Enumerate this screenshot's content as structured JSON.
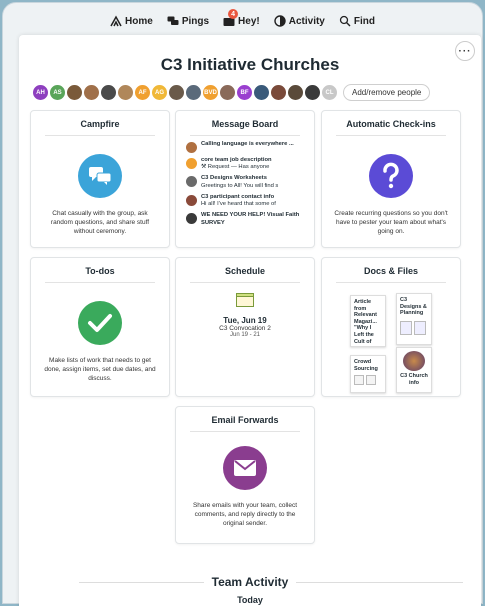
{
  "nav": {
    "home": "Home",
    "pings": "Pings",
    "hey": "Hey!",
    "hey_badge": "4",
    "activity": "Activity",
    "find": "Find"
  },
  "project": {
    "title": "C3 Initiative Churches",
    "add_people": "Add/remove people",
    "avatars": [
      {
        "initials": "AH",
        "color": "#8e3fbf"
      },
      {
        "initials": "AS",
        "color": "#5aa55a"
      },
      {
        "initials": "",
        "color": "#7a5a3a"
      },
      {
        "initials": "",
        "color": "#a0704a"
      },
      {
        "initials": "",
        "color": "#4a4a4a"
      },
      {
        "initials": "",
        "color": "#b0875a"
      },
      {
        "initials": "AF",
        "color": "#f0a030"
      },
      {
        "initials": "AG",
        "color": "#f0b838"
      },
      {
        "initials": "",
        "color": "#6a5a4a"
      },
      {
        "initials": "",
        "color": "#5a6a7a"
      },
      {
        "initials": "BVD",
        "color": "#f0a030"
      },
      {
        "initials": "",
        "color": "#8a6a5a"
      },
      {
        "initials": "BF",
        "color": "#9a3fcf"
      },
      {
        "initials": "",
        "color": "#3a5a7a"
      },
      {
        "initials": "",
        "color": "#7a4a3a"
      },
      {
        "initials": "",
        "color": "#5a4a3a"
      },
      {
        "initials": "",
        "color": "#3a3a3a"
      },
      {
        "initials": "CL",
        "color": "#c8c8c8"
      }
    ]
  },
  "cards": {
    "campfire": {
      "title": "Campfire",
      "desc": "Chat casually with the group, ask random questions, and share stuff without ceremony."
    },
    "message_board": {
      "title": "Message Board",
      "messages": [
        {
          "title": "Calling language is everywhere ...",
          "snippet": "",
          "color": "#b07040"
        },
        {
          "title": "core team job description",
          "snippet": "⚒ Request — Has anyone",
          "color": "#f0a030"
        },
        {
          "title": "C3 Designs Worksheets",
          "snippet": "Greetings to All! You will find s",
          "color": "#6a6a6a"
        },
        {
          "title": "C3 participant contact info",
          "snippet": "Hi all! I've heard that some of",
          "color": "#8a4a3a"
        },
        {
          "title": "WE NEED YOUR HELP! Visual Faith SURVEY",
          "snippet": "",
          "color": "#3a3a3a"
        }
      ]
    },
    "checkins": {
      "title": "Automatic Check-ins",
      "desc": "Create recurring questions so you don't have to pester your team about what's going on."
    },
    "todos": {
      "title": "To-dos",
      "desc": "Make lists of work that needs to get done, assign items, set due dates, and discuss."
    },
    "schedule": {
      "title": "Schedule",
      "date": "Tue, Jun 19",
      "event": "C3 Convocation 2",
      "range": "Jun 19 - 21"
    },
    "docs": {
      "title": "Docs & Files",
      "doc1": "Article from Relevant Magazi... \"Why I Left the Cult of",
      "doc2": "C3 Designs & Planning",
      "doc3": "Crowd Sourcing",
      "doc4": "C3 Church info"
    },
    "email": {
      "title": "Email Forwards",
      "desc": "Share emails with your team, collect comments, and reply directly to the original sender."
    }
  },
  "activity": {
    "title": "Team Activity",
    "today": "Today"
  },
  "colors": {
    "campfire": "#3ba4d9",
    "checkins": "#5b4bd6",
    "todos": "#3aaa5c",
    "email": "#8a3d8f"
  }
}
